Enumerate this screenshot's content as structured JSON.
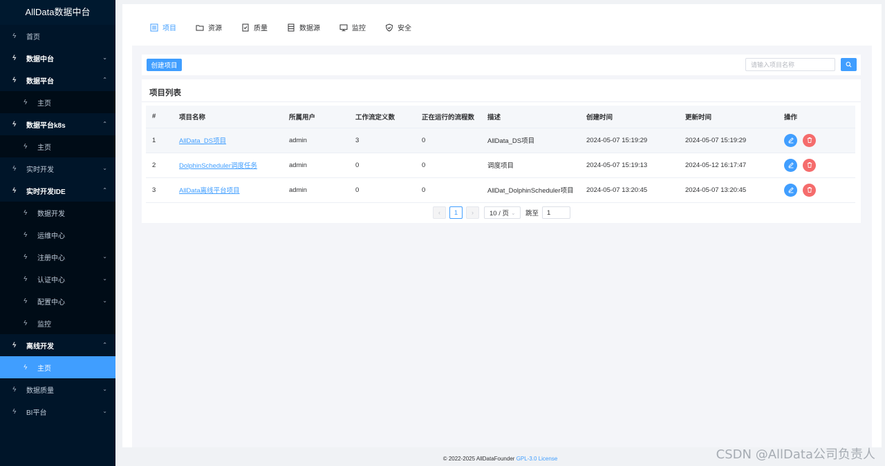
{
  "app": {
    "title": "AllData数据中台"
  },
  "sidebar": {
    "items": [
      {
        "label": "首页",
        "icon": "bolt-icon",
        "level": "top"
      },
      {
        "label": "数据中台",
        "icon": "bolt-icon",
        "level": "top",
        "arrow": "down",
        "open": true
      },
      {
        "label": "数据平台",
        "icon": "bolt-icon",
        "level": "top",
        "arrow": "up",
        "open": true
      },
      {
        "label": "主页",
        "icon": "bolt-icon",
        "level": "sub"
      },
      {
        "label": "数据平台k8s",
        "icon": "bolt-icon",
        "level": "top",
        "arrow": "up",
        "open": true
      },
      {
        "label": "主页",
        "icon": "bolt-icon",
        "level": "sub"
      },
      {
        "label": "实时开发",
        "icon": "bolt-icon",
        "level": "top",
        "arrow": "down"
      },
      {
        "label": "实时开发IDE",
        "icon": "bolt-icon",
        "level": "top",
        "arrow": "up",
        "open": true
      },
      {
        "label": "数据开发",
        "icon": "bolt-icon",
        "level": "sub"
      },
      {
        "label": "运维中心",
        "icon": "bolt-icon",
        "level": "sub"
      },
      {
        "label": "注册中心",
        "icon": "bolt-icon",
        "level": "sub",
        "arrow": "down"
      },
      {
        "label": "认证中心",
        "icon": "bolt-icon",
        "level": "sub",
        "arrow": "down"
      },
      {
        "label": "配置中心",
        "icon": "bolt-icon",
        "level": "sub",
        "arrow": "down"
      },
      {
        "label": "监控",
        "icon": "bolt-icon",
        "level": "sub"
      },
      {
        "label": "离线开发",
        "icon": "bolt-icon",
        "level": "top",
        "arrow": "up",
        "open": true
      },
      {
        "label": "主页",
        "icon": "bolt-icon",
        "level": "sub",
        "active": true
      },
      {
        "label": "数据质量",
        "icon": "bolt-icon",
        "level": "top",
        "arrow": "down"
      },
      {
        "label": "BI平台",
        "icon": "bolt-icon",
        "level": "top",
        "arrow": "down"
      }
    ]
  },
  "topnav": {
    "tabs": [
      {
        "label": "项目",
        "icon": "list-icon",
        "active": true
      },
      {
        "label": "资源",
        "icon": "folder-icon"
      },
      {
        "label": "质量",
        "icon": "document-check-icon"
      },
      {
        "label": "数据源",
        "icon": "database-icon"
      },
      {
        "label": "监控",
        "icon": "monitor-icon"
      },
      {
        "label": "安全",
        "icon": "shield-icon"
      }
    ]
  },
  "toolbar": {
    "create_label": "创建项目",
    "search_placeholder": "请输入项目名称"
  },
  "project_list": {
    "title": "项目列表",
    "columns": [
      "#",
      "项目名称",
      "所属用户",
      "工作流定义数",
      "正在运行的流程数",
      "描述",
      "创建时间",
      "更新时间",
      "操作"
    ],
    "rows": [
      {
        "index": "1",
        "name": "AllData_DS项目",
        "user": "admin",
        "workflow_defs": "3",
        "running": "0",
        "desc": "AllData_DS项目",
        "created": "2024-05-07 15:19:29",
        "updated": "2024-05-07 15:19:29",
        "highlight": true
      },
      {
        "index": "2",
        "name": "DolphinScheduler调度任务",
        "user": "admin",
        "workflow_defs": "0",
        "running": "0",
        "desc": "调度项目",
        "created": "2024-05-07 15:19:13",
        "updated": "2024-05-12 16:17:47"
      },
      {
        "index": "3",
        "name": "AllData离线平台项目",
        "user": "admin",
        "workflow_defs": "0",
        "running": "0",
        "desc": "AllDat_DolphinScheduler项目",
        "created": "2024-05-07 13:20:45",
        "updated": "2024-05-07 13:20:45"
      }
    ]
  },
  "pagination": {
    "current_page": "1",
    "page_size": "10 / 页",
    "jump_label": "跳至",
    "jump_value": "1"
  },
  "footer": {
    "copyright": "© 2022-2025 AllDataFounder",
    "license": "GPL-3.0 License"
  },
  "watermark": "CSDN @AllData公司负责人",
  "colors": {
    "accent": "#409eff",
    "danger": "#f56c6c",
    "sidebar_bg": "#001529"
  }
}
